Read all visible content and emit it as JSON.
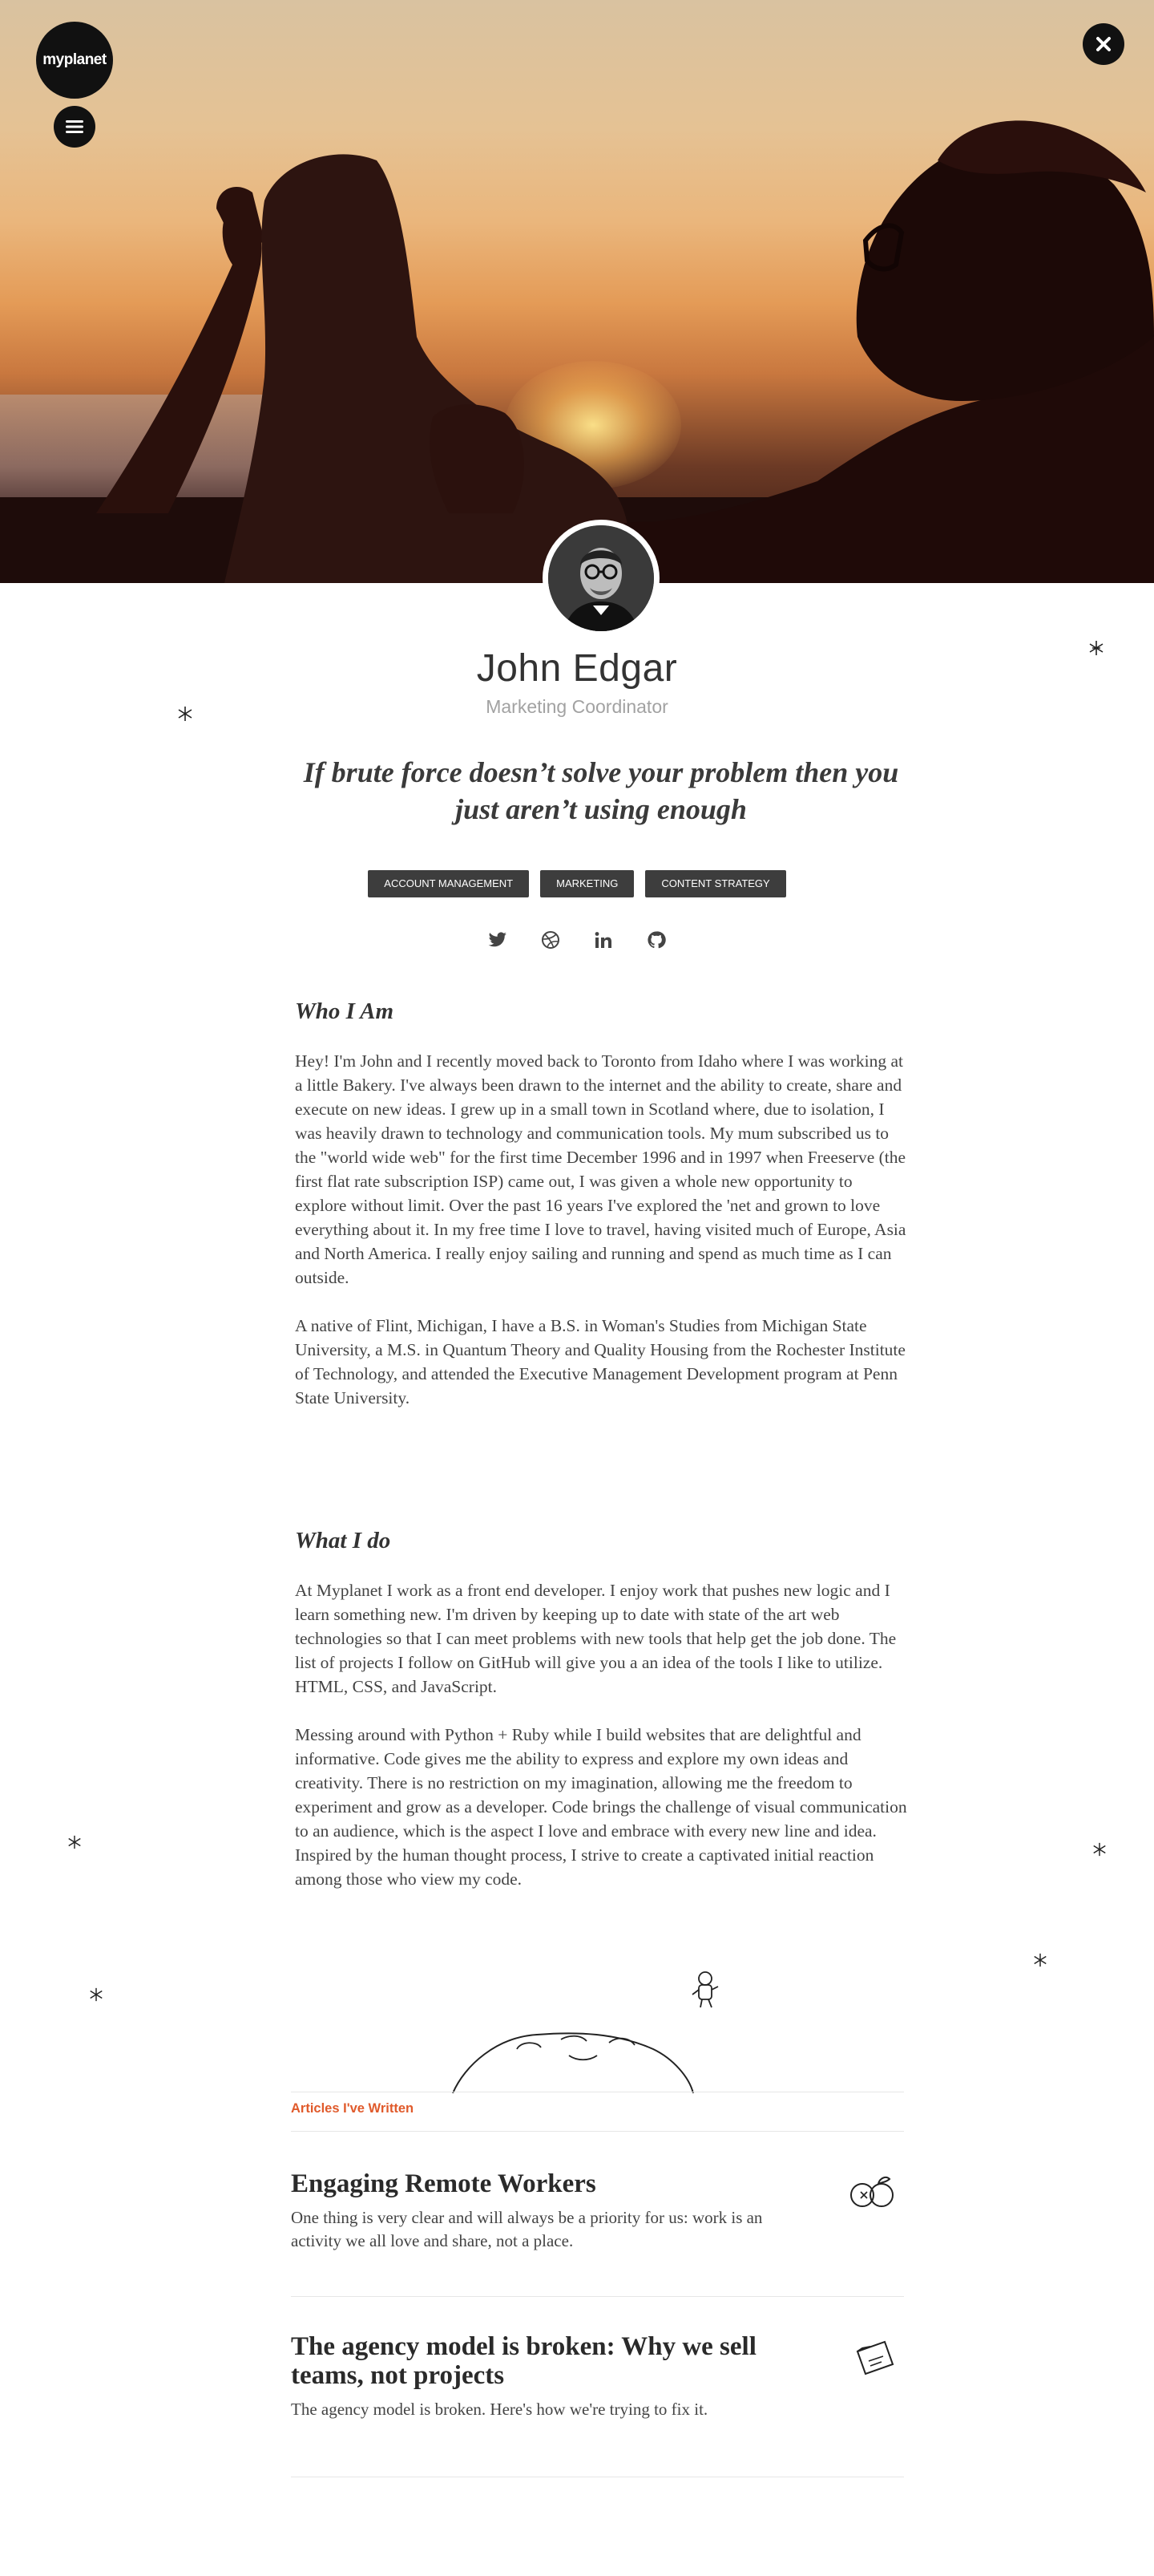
{
  "brand": {
    "logo_text": "myplanet"
  },
  "profile": {
    "name": "John Edgar",
    "role": "Marketing Coordinator",
    "quote": "If brute force doesn’t solve your problem then you just aren’t using enough",
    "tags": [
      "ACCOUNT MANAGEMENT",
      "MARKETING",
      "CONTENT STRATEGY"
    ],
    "social": [
      "twitter-icon",
      "dribbble-icon",
      "linkedin-icon",
      "github-icon"
    ]
  },
  "who": {
    "heading": "Who I Am",
    "p1": "Hey! I'm John and I recently moved back to Toronto from Idaho where I was working at a little Bakery. I've always been drawn to the internet and the ability to create, share and execute on new ideas. I grew up in a small town in Scotland where, due to isolation, I was heavily drawn to technology and communication tools. My mum subscribed us to the \"world wide web\" for the first time December 1996 and in 1997 when Freeserve (the first flat rate subscription ISP) came out, I was given a whole new opportunity to explore without limit. Over the past 16 years I've explored the 'net and grown to love everything about it. In my free time I love to travel, having visited much of Europe, Asia and North America. I really enjoy sailing and running and spend as much time as I can outside.",
    "p2": "A native of Flint, Michigan, I  have a B.S. in Woman's Studies from Michigan State University, a M.S. in Quantum Theory and Quality Housing from the Rochester Institute of Technology, and  attended the Executive Management Development program at Penn State University."
  },
  "what": {
    "heading": "What I do",
    "p1": "At Myplanet I work as a front end developer. I enjoy work that pushes new logic and I learn something new. I'm driven by keeping up to date with state of the art web technologies so that I can meet problems with new tools that help get the job done. The list of projects I follow on GitHub will give you a an idea of the tools I like to utilize. HTML, CSS, and JavaScript.",
    "p2": "Messing around with Python + Ruby while I build websites that are delightful and informative.  Code gives me the ability to express and explore my own ideas and creativity. There is no restriction on my imagination, allowing me the freedom to experiment and grow as a developer. Code brings the challenge of visual communication to an audience, which is the aspect I love and embrace with every new line and idea. Inspired by the human thought process, I strive to create a captivated initial reaction among those who view my code."
  },
  "articles": {
    "label": "Articles I've Written",
    "items": [
      {
        "title": "Engaging Remote Workers",
        "summary": "One thing is very clear and will always be a priority for us: work is an activity we all love and share, not a place.",
        "icon": "doodle-apples-icon"
      },
      {
        "title": "The agency model is broken: Why we sell teams, not projects",
        "summary": "The agency model is broken. Here's how we're trying to fix it.",
        "icon": "doodle-folder-icon"
      }
    ]
  },
  "colors": {
    "accent": "#e05a2b",
    "tag_bg": "#3d3d3d",
    "dark": "#111111"
  }
}
